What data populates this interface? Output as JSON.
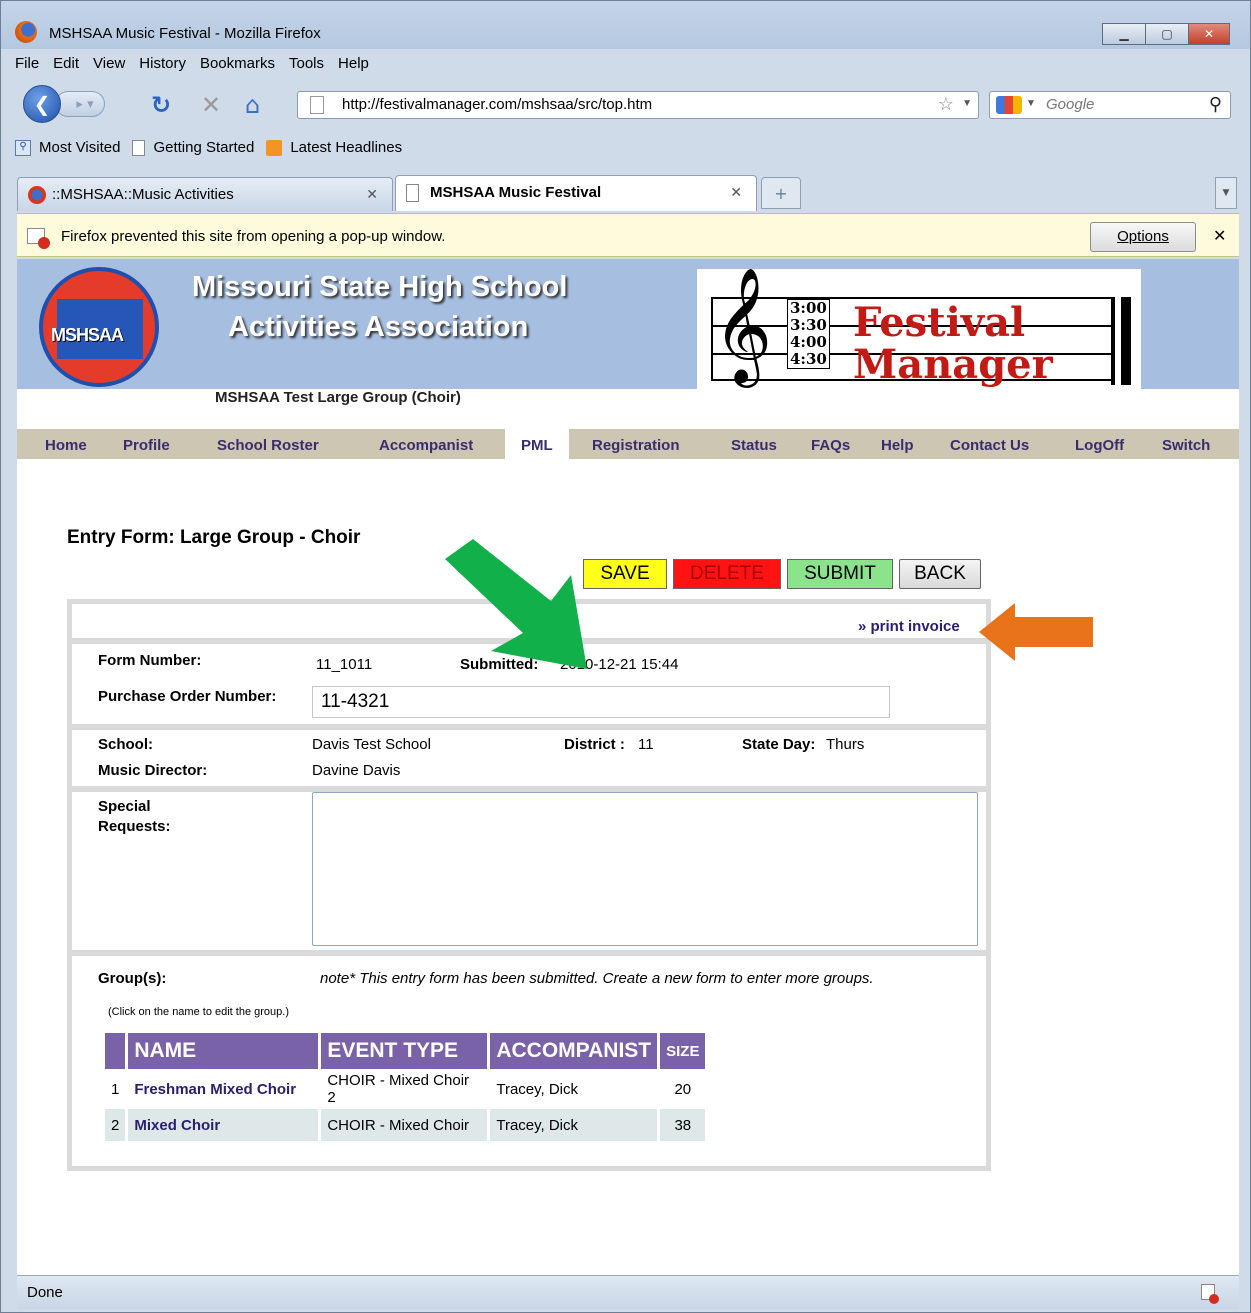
{
  "window": {
    "title": "MSHSAA Music Festival - Mozilla Firefox"
  },
  "menu": [
    "File",
    "Edit",
    "View",
    "History",
    "Bookmarks",
    "Tools",
    "Help"
  ],
  "toolbar": {
    "url": "http://festivalmanager.com/mshsaa/src/top.htm",
    "search_placeholder": "Google"
  },
  "bookmarks": [
    "Most Visited",
    "Getting Started",
    "Latest Headlines"
  ],
  "tabs": [
    {
      "label": "::MSHSAA::Music Activities",
      "active": false
    },
    {
      "label": "MSHSAA Music Festival",
      "active": true
    }
  ],
  "popup": {
    "message": "Firefox prevented this site from opening a pop-up window.",
    "options_label": "Options"
  },
  "header": {
    "org_line1": "Missouri State High School",
    "org_line2": "Activities Association",
    "seal_text": "MSHSAA",
    "subtitle": "MSHSAA Test Large Group (Choir)",
    "fm_times": [
      "3:00",
      "3:30",
      "4:00",
      "4:30"
    ],
    "fm_line1": "Festival",
    "fm_line2": "Manager"
  },
  "nav": [
    "Home",
    "Profile",
    "School Roster",
    "Accompanist",
    "PML",
    "Registration",
    "Status",
    "FAQs",
    "Help",
    "Contact Us",
    "LogOff",
    "Switch"
  ],
  "nav_active": "PML",
  "form": {
    "title": "Entry Form: Large Group - Choir",
    "buttons": {
      "save": "SAVE",
      "delete": "DELETE",
      "submit": "SUBMIT",
      "back": "BACK"
    },
    "print_invoice": "» print invoice",
    "form_number_label": "Form Number:",
    "form_number": "11_1011",
    "submitted_label": "Submitted:",
    "submitted": "2010-12-21 15:44",
    "po_label": "Purchase Order Number:",
    "po_value": "11-4321",
    "school_label": "School:",
    "school": "Davis Test School",
    "district_label": "District :",
    "district": "11",
    "state_day_label": "State Day:",
    "state_day": "Thurs",
    "director_label": "Music Director:",
    "director": "Davine Davis",
    "special_label_1": "Special",
    "special_label_2": "Requests:",
    "special_value": "",
    "groups_label": "Group(s):",
    "note": "note* This entry form has been submitted. Create a new form to enter more groups.",
    "hint": "(Click on the name to edit the group.)",
    "columns": [
      "NAME",
      "EVENT TYPE",
      "ACCOMPANIST",
      "SIZE"
    ],
    "rows": [
      {
        "num": "1",
        "name": "Freshman Mixed Choir",
        "event": "CHOIR - Mixed Choir 2",
        "accompanist": "Tracey, Dick",
        "size": "20"
      },
      {
        "num": "2",
        "name": "Mixed Choir",
        "event": "CHOIR - Mixed Choir",
        "accompanist": "Tracey, Dick",
        "size": "38"
      }
    ]
  },
  "status": {
    "text": "Done"
  },
  "colors": {
    "arrow_green": "#12b04b",
    "arrow_orange": "#e8731a",
    "nav_bg": "#ccc6b2",
    "table_header": "#7a62a8"
  }
}
